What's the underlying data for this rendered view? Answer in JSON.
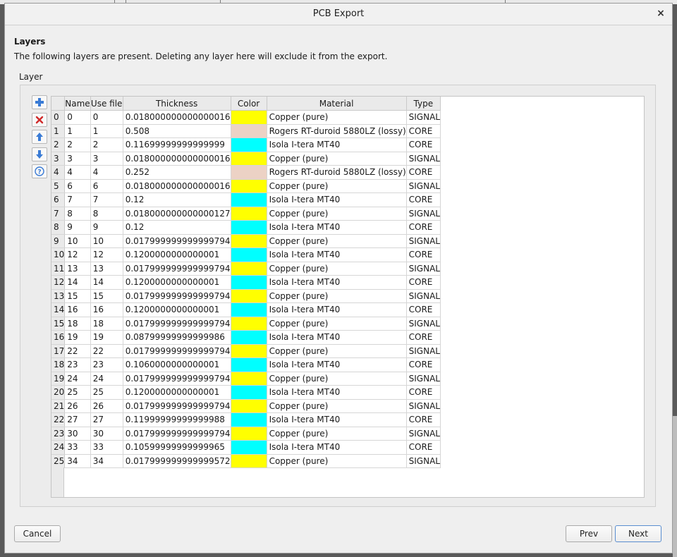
{
  "window": {
    "title": "PCB Export",
    "close_label": "×"
  },
  "section": {
    "title": "Layers",
    "description": "The following layers are present. Deleting any layer here will exclude it from the export."
  },
  "group": {
    "label": "Layer"
  },
  "toolbar": {
    "buttons": [
      {
        "icon": "plus-icon",
        "color": "#3a7bd5"
      },
      {
        "icon": "delete-icon",
        "color": "#d02a2a"
      },
      {
        "icon": "arrow-up-icon",
        "color": "#3a7bd5"
      },
      {
        "icon": "arrow-down-icon",
        "color": "#3a7bd5"
      },
      {
        "icon": "help-icon",
        "color": "#3a7bd5"
      }
    ]
  },
  "table": {
    "columns": [
      "Name",
      "Use file",
      "Thickness",
      "Color",
      "Material",
      "Type"
    ],
    "rows": [
      {
        "index": "0",
        "name": "0",
        "use_file": "0",
        "thickness": "0.018000000000000016",
        "color": "#ffff00",
        "material": "Copper (pure)",
        "type": "SIGNAL"
      },
      {
        "index": "1",
        "name": "1",
        "use_file": "1",
        "thickness": "0.508",
        "color": "#ecd2c5",
        "material": "Rogers RT-duroid 5880LZ (lossy)",
        "type": "CORE"
      },
      {
        "index": "2",
        "name": "2",
        "use_file": "2",
        "thickness": "0.11699999999999999",
        "color": "#00ffff",
        "material": "Isola I-tera MT40",
        "type": "CORE"
      },
      {
        "index": "3",
        "name": "3",
        "use_file": "3",
        "thickness": "0.018000000000000016",
        "color": "#ffff00",
        "material": "Copper (pure)",
        "type": "SIGNAL"
      },
      {
        "index": "4",
        "name": "4",
        "use_file": "4",
        "thickness": "0.252",
        "color": "#ecd2c5",
        "material": "Rogers RT-duroid 5880LZ (lossy)",
        "type": "CORE"
      },
      {
        "index": "5",
        "name": "6",
        "use_file": "6",
        "thickness": "0.018000000000000016",
        "color": "#ffff00",
        "material": "Copper (pure)",
        "type": "SIGNAL"
      },
      {
        "index": "6",
        "name": "7",
        "use_file": "7",
        "thickness": "0.12",
        "color": "#00ffff",
        "material": "Isola I-tera MT40",
        "type": "CORE"
      },
      {
        "index": "7",
        "name": "8",
        "use_file": "8",
        "thickness": "0.018000000000000127",
        "color": "#ffff00",
        "material": "Copper (pure)",
        "type": "SIGNAL"
      },
      {
        "index": "8",
        "name": "9",
        "use_file": "9",
        "thickness": "0.12",
        "color": "#00ffff",
        "material": "Isola I-tera MT40",
        "type": "CORE"
      },
      {
        "index": "9",
        "name": "10",
        "use_file": "10",
        "thickness": "0.017999999999999794",
        "color": "#ffff00",
        "material": "Copper (pure)",
        "type": "SIGNAL"
      },
      {
        "index": "10",
        "name": "12",
        "use_file": "12",
        "thickness": "0.1200000000000001",
        "color": "#00ffff",
        "material": "Isola I-tera MT40",
        "type": "CORE"
      },
      {
        "index": "11",
        "name": "13",
        "use_file": "13",
        "thickness": "0.017999999999999794",
        "color": "#ffff00",
        "material": "Copper (pure)",
        "type": "SIGNAL"
      },
      {
        "index": "12",
        "name": "14",
        "use_file": "14",
        "thickness": "0.1200000000000001",
        "color": "#00ffff",
        "material": "Isola I-tera MT40",
        "type": "CORE"
      },
      {
        "index": "13",
        "name": "15",
        "use_file": "15",
        "thickness": "0.017999999999999794",
        "color": "#ffff00",
        "material": "Copper (pure)",
        "type": "SIGNAL"
      },
      {
        "index": "14",
        "name": "16",
        "use_file": "16",
        "thickness": "0.1200000000000001",
        "color": "#00ffff",
        "material": "Isola I-tera MT40",
        "type": "CORE"
      },
      {
        "index": "15",
        "name": "18",
        "use_file": "18",
        "thickness": "0.017999999999999794",
        "color": "#ffff00",
        "material": "Copper (pure)",
        "type": "SIGNAL"
      },
      {
        "index": "16",
        "name": "19",
        "use_file": "19",
        "thickness": "0.08799999999999986",
        "color": "#00ffff",
        "material": "Isola I-tera MT40",
        "type": "CORE"
      },
      {
        "index": "17",
        "name": "22",
        "use_file": "22",
        "thickness": "0.017999999999999794",
        "color": "#ffff00",
        "material": "Copper (pure)",
        "type": "SIGNAL"
      },
      {
        "index": "18",
        "name": "23",
        "use_file": "23",
        "thickness": "0.1060000000000001",
        "color": "#00ffff",
        "material": "Isola I-tera MT40",
        "type": "CORE"
      },
      {
        "index": "19",
        "name": "24",
        "use_file": "24",
        "thickness": "0.017999999999999794",
        "color": "#ffff00",
        "material": "Copper (pure)",
        "type": "SIGNAL"
      },
      {
        "index": "20",
        "name": "25",
        "use_file": "25",
        "thickness": "0.1200000000000001",
        "color": "#00ffff",
        "material": "Isola I-tera MT40",
        "type": "CORE"
      },
      {
        "index": "21",
        "name": "26",
        "use_file": "26",
        "thickness": "0.017999999999999794",
        "color": "#ffff00",
        "material": "Copper (pure)",
        "type": "SIGNAL"
      },
      {
        "index": "22",
        "name": "27",
        "use_file": "27",
        "thickness": "0.11999999999999988",
        "color": "#00ffff",
        "material": "Isola I-tera MT40",
        "type": "CORE"
      },
      {
        "index": "23",
        "name": "30",
        "use_file": "30",
        "thickness": "0.017999999999999794",
        "color": "#ffff00",
        "material": "Copper (pure)",
        "type": "SIGNAL"
      },
      {
        "index": "24",
        "name": "33",
        "use_file": "33",
        "thickness": "0.10599999999999965",
        "color": "#00ffff",
        "material": "Isola I-tera MT40",
        "type": "CORE"
      },
      {
        "index": "25",
        "name": "34",
        "use_file": "34",
        "thickness": "0.017999999999999572",
        "color": "#ffff00",
        "material": "Copper (pure)",
        "type": "SIGNAL"
      }
    ]
  },
  "buttons": {
    "cancel": "Cancel",
    "prev": "Prev",
    "next": "Next"
  }
}
